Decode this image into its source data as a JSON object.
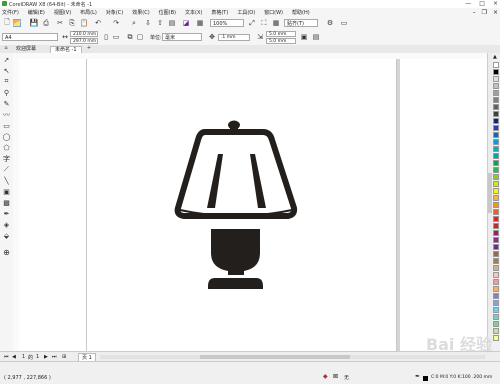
{
  "window": {
    "title": "CorelDRAW X8 (64-Bit) - 未命名 -1",
    "controls": [
      "—",
      "□",
      "×"
    ]
  },
  "menubar": {
    "items": [
      "文件(F)",
      "编辑(E)",
      "视图(V)",
      "布局(L)",
      "对象(C)",
      "效果(C)",
      "位图(B)",
      "文本(X)",
      "表格(T)",
      "工具(O)",
      "窗口(W)",
      "帮助(H)"
    ]
  },
  "toolbar": {
    "zoom_value": "100%",
    "snap_label": "贴齐(T)",
    "icons": [
      "new-icon",
      "open-icon",
      "save-icon",
      "print-icon",
      "cut-icon",
      "copy-icon",
      "paste-icon",
      "undo-icon",
      "redo-icon",
      "search-icon",
      "import-icon",
      "export-icon",
      "publish-icon",
      "corel-connect-icon",
      "welcome-icon",
      "zoom-full-icon",
      "full-screen-icon",
      "grid-icon",
      "rulers-icon",
      "settings-icon",
      "launch-icon"
    ]
  },
  "propertybar": {
    "paper_size": "A4",
    "width": "210.0 mm",
    "height": "297.0 mm",
    "units_label": "单位:",
    "units_value": "毫米",
    "nudge": ".1 mm",
    "dup_x": "5.0 mm",
    "dup_y": "5.0 mm"
  },
  "tabs": [
    {
      "label": "欢迎屏幕",
      "active": false
    },
    {
      "label": "未命名 -1",
      "active": true
    }
  ],
  "pager": {
    "current": "1",
    "of": "的",
    "total": "1",
    "page_tab": "页 1"
  },
  "status": {
    "coords": "( 2,977 , 227,866 )",
    "fill_label": "无",
    "outline_info": "C:0 M:0 Y:0 K:100  .200 mm"
  },
  "watermark": "Bai 经验",
  "colors": {
    "lamp": "#231f1c",
    "canvas": "#ffffff",
    "chrome": "#f0f0f0"
  },
  "palette": [
    "#ffffff",
    "#000000",
    "#e0e0e0",
    "#c0c0c0",
    "#a0a0a0",
    "#808080",
    "#606060",
    "#404040",
    "#1b1e88",
    "#2d3da8",
    "#0072bc",
    "#00a0e3",
    "#00b0c8",
    "#00a88e",
    "#00a651",
    "#39b54a",
    "#8dc63f",
    "#d7df23",
    "#fff200",
    "#fcb040",
    "#f7941d",
    "#f15a29",
    "#ed1c24",
    "#c1272d",
    "#9e1f63",
    "#92278f",
    "#662d91",
    "#8b6d4f",
    "#a67c52",
    "#c7b299",
    "#f9c9b6",
    "#f6989d",
    "#fbaf5d",
    "#8781bd",
    "#7da7d9",
    "#6dcff6",
    "#7accc8",
    "#82ca9c",
    "#c4df9b",
    "#fff799"
  ]
}
